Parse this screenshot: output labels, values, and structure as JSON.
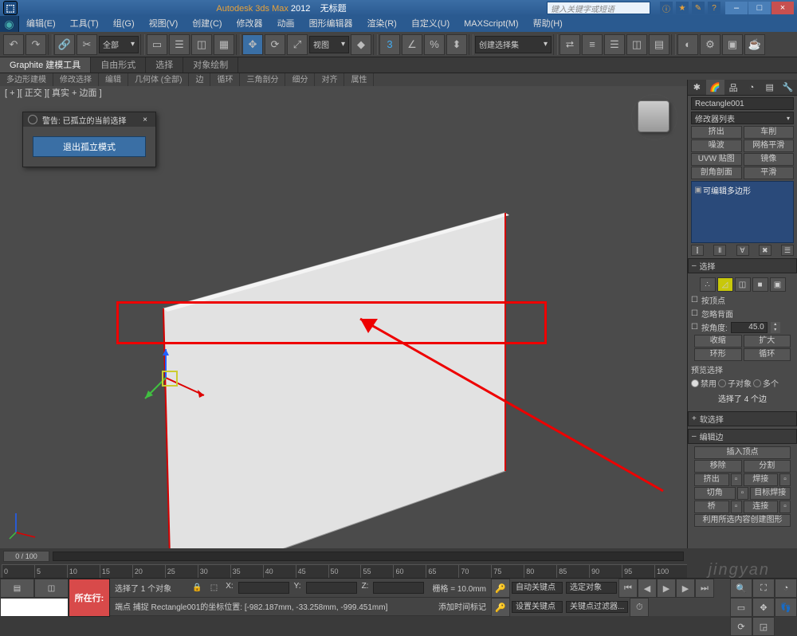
{
  "title": {
    "app": "Autodesk 3ds Max",
    "version": "2012",
    "untitled": "无标题",
    "search_ph": "键入关键字或短语"
  },
  "winbtns": {
    "min": "–",
    "max": "□",
    "close": "×"
  },
  "menu": [
    "编辑(E)",
    "工具(T)",
    "组(G)",
    "视图(V)",
    "创建(C)",
    "修改器",
    "动画",
    "图形编辑器",
    "渲染(R)",
    "自定义(U)",
    "MAXScript(M)",
    "帮助(H)"
  ],
  "toolbar": {
    "all": "全部",
    "view": "视图",
    "createset": "创建选择集"
  },
  "ribbon_tabs": [
    "Graphite 建模工具",
    "自由形式",
    "选择",
    "对象绘制"
  ],
  "ribbon2": [
    "多边形建模",
    "修改选择",
    "编辑",
    "几何体 (全部)",
    "边",
    "循环",
    "三角剖分",
    "细分",
    "对齐",
    "属性"
  ],
  "viewport_label": "[ + ][ 正交 ][ 真实 + 边面 ]",
  "warn_dlg": {
    "title": "警告: 已孤立的当前选择",
    "btn": "退出孤立模式"
  },
  "right": {
    "obj_name": "Rectangle001",
    "mod_list_label": "修改器列表",
    "btns_row1": [
      "挤出",
      "车削"
    ],
    "btns_row2": [
      "噪波",
      "网格平滑"
    ],
    "btns_row3": [
      "UVW 贴图",
      "镜像"
    ],
    "btns_row4": [
      "剖角剖面",
      "平滑"
    ],
    "mod_stack": "可编辑多边形",
    "sel_title": "选择",
    "chk_vert": "按顶点",
    "chk_back": "忽略背面",
    "chk_angle": "按角度:",
    "angle_val": "45.0",
    "btn_shrink": "收缩",
    "btn_grow": "扩大",
    "btn_ring": "环形",
    "btn_loop": "循环",
    "preview_title": "预览选择",
    "r_disable": "禁用",
    "r_sub": "子对象",
    "r_multi": "多个",
    "sel_status": "选择了 4 个边",
    "soft_sel": "软选择",
    "edit_edge": "编辑边",
    "ins_vert": "插入顶点",
    "remove": "移除",
    "split": "分割",
    "extrude": "挤出",
    "weld": "焊接",
    "chamfer": "切角",
    "target_weld": "目标焊接",
    "bridge": "桥",
    "connect": "连接",
    "create_shape": "利用所选内容创建图形"
  },
  "timeline": {
    "frame": "0 / 100",
    "ticks": [
      "0",
      "5",
      "10",
      "15",
      "20",
      "25",
      "30",
      "35",
      "40",
      "45",
      "50",
      "55",
      "60",
      "65",
      "70",
      "75",
      "80",
      "85",
      "90",
      "95",
      "100"
    ]
  },
  "status": {
    "now": "所在行:",
    "sel_count": "选择了 1 个对象",
    "snap_info": "端点 捕捉 Rectangle001的坐标位置: [-982.187mm, -33.258mm, -999.451mm]",
    "x_lab": "X:",
    "y_lab": "Y:",
    "z_lab": "Z:",
    "grid": "栅格 = 10.0mm",
    "auto_key": "自动关键点",
    "set_key": "设置关键点",
    "sel_obj": "选定对象",
    "kf_filter": "关键点过滤器...",
    "add_time_tag": "添加时间标记"
  },
  "wm": "jingyan"
}
